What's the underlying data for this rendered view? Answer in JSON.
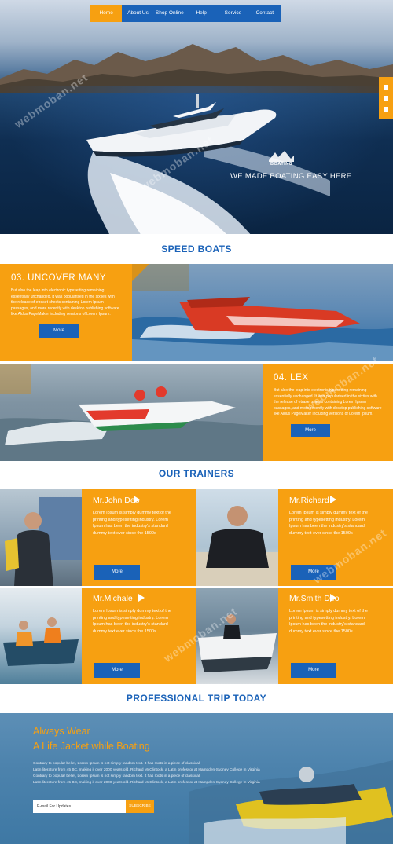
{
  "nav": {
    "items": [
      "Home",
      "About Us",
      "Shop Online",
      "Help",
      "Service",
      "Contact"
    ]
  },
  "hero": {
    "logo_text": "BOATING",
    "tagline": "WE MADE BOATING EASY HERE"
  },
  "speed_boats": {
    "title": "SPEED BOATS",
    "items": [
      {
        "heading": "03. UNCOVER MANY",
        "text": "But also the leap into electronic typesetting remaining essentially unchanged. It was popularised in the sixties with the release of etraset sheets containing Lorem Ipsum passages, and more recently with desktop publishing software like Aldus PageMaker including versions of Lorem Ipsum.",
        "button": "More"
      },
      {
        "heading": "04. LEX",
        "text": "But also the leap into electronic typesetting remaining essentially unchanged. It was popularised in the sixties with the release of etraset sheets containing Lorem Ipsum passages, and more recently with desktop publishing software like Aldus PageMaker including versions of Lorem Ipsum.",
        "button": "More"
      }
    ]
  },
  "trainers": {
    "title": "OUR TRAINERS",
    "items": [
      {
        "name": "Mr.John Deo",
        "text": "Lorem Ipsum is simply dummy text of the printing and typesetting industry. Lorem Ipsum has been the industry's standard dummy text ever since the 1500s",
        "button": "More"
      },
      {
        "name": "Mr.Richard",
        "text": "Lorem Ipsum is simply dummy text of the printing and typesetting industry. Lorem Ipsum has been the industry's standard dummy text ever since the 1500s",
        "button": "More"
      },
      {
        "name": "Mr.Michale",
        "text": "Lorem Ipsum is simply dummy text of the printing and typesetting industry. Lorem Ipsum has been the industry's standard dummy text ever since the 1500s",
        "button": "More"
      },
      {
        "name": "Mr.Smith Deo",
        "text": "Lorem Ipsum is simply dummy text of the printing and typesetting industry. Lorem Ipsum has been the industry's standard dummy text ever since the 1500s",
        "button": "More"
      }
    ]
  },
  "trip": {
    "title": "PROFESSIONAL TRIP TODAY",
    "heading_line1": "Always Wear",
    "heading_line2": "A Life Jacket while Boating",
    "lines": [
      "Contrary to popular belief, Lorem Ipsum is not simply random text. It has roots in a piece of classical",
      "Latin literature from 45 BC, making it over 2000 years old. Richard McClintock, a Latin professor at Hampden-Sydney College in Virginia",
      "Contrary to popular belief, Lorem Ipsum is not simply random text. It has roots in a piece of classical",
      "Latin literature from 45 BC, making it over 2000 years old. Richard McClintock, a Latin professor at Hampden-Sydney College in Virginia"
    ],
    "email_placeholder": "E-mail For Updates",
    "subscribe_label": "SUBSCRIBE"
  },
  "watermark": "webmoban.net",
  "colors": {
    "orange": "#f7a011",
    "blue": "#1a62b8"
  }
}
